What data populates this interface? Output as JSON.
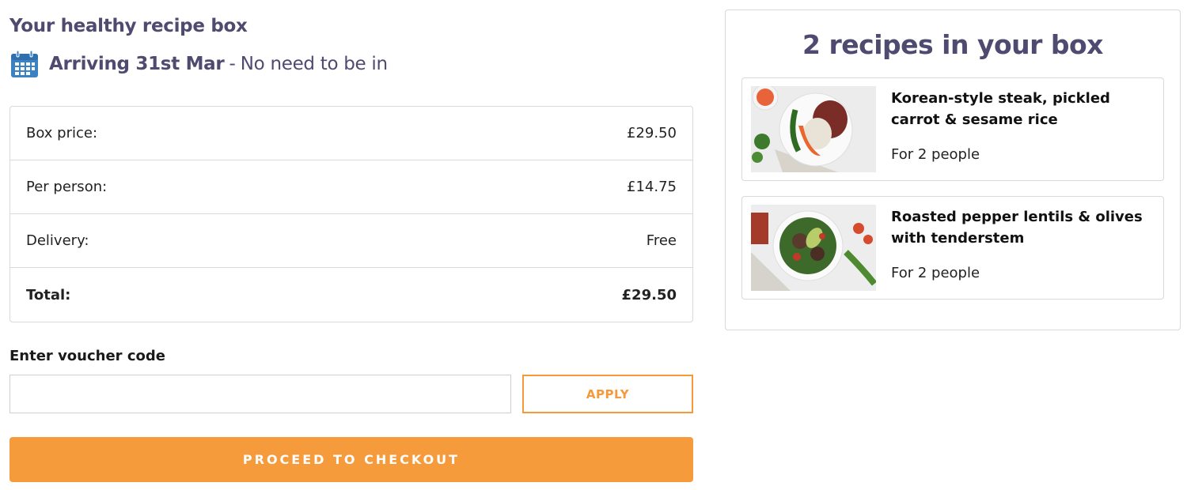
{
  "header": {
    "title": "Your healthy recipe box",
    "arriving_strong": "Arriving 31st Mar",
    "arriving_separator": "-",
    "arriving_rest": "No need to be in",
    "calendar_icon": "calendar-icon"
  },
  "pricing": {
    "rows": [
      {
        "label": "Box price:",
        "value": "£29.50"
      },
      {
        "label": "Per person:",
        "value": "£14.75"
      },
      {
        "label": "Delivery:",
        "value": "Free"
      },
      {
        "label": "Total:",
        "value": "£29.50"
      }
    ]
  },
  "voucher": {
    "label": "Enter voucher code",
    "value": "",
    "apply_label": "APPLY"
  },
  "checkout": {
    "label": "PROCEED TO CHECKOUT"
  },
  "box": {
    "title": "2 recipes in your box",
    "recipes": [
      {
        "name": "Korean-style steak, pickled carrot & sesame rice",
        "people": "For 2 people"
      },
      {
        "name": "Roasted pepper lentils & olives with tenderstem",
        "people": "For 2 people"
      }
    ]
  },
  "colors": {
    "heading": "#4e4a70",
    "accent": "#f59b3c",
    "calendar_blue": "#3b82c4",
    "border": "#d9d9d9"
  }
}
